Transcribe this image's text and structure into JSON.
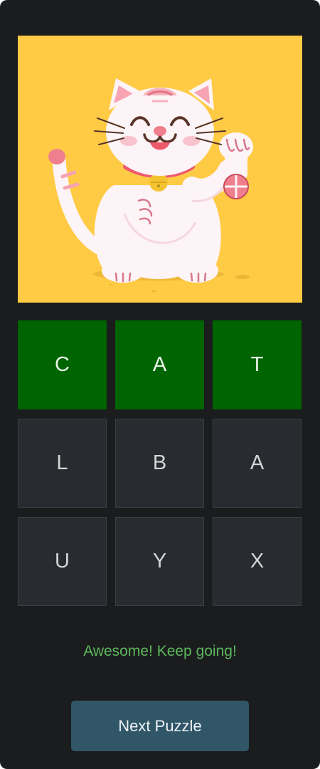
{
  "puzzle": {
    "image": {
      "icon": "maneki-neko-lucky-cat",
      "background_color": "#ffcb45"
    },
    "letters": [
      {
        "letter": "C",
        "state": "selected"
      },
      {
        "letter": "A",
        "state": "selected"
      },
      {
        "letter": "T",
        "state": "selected"
      },
      {
        "letter": "L",
        "state": "available"
      },
      {
        "letter": "B",
        "state": "available"
      },
      {
        "letter": "A",
        "state": "available"
      },
      {
        "letter": "U",
        "state": "available"
      },
      {
        "letter": "Y",
        "state": "available"
      },
      {
        "letter": "X",
        "state": "available"
      }
    ],
    "message": "Awesome! Keep going!",
    "next_button_label": "Next Puzzle"
  },
  "colors": {
    "app_background": "#1b1c1e",
    "tile_selected": "#006400",
    "tile_available": "#282b2f",
    "message": "#5cb85c",
    "button": "#315668"
  }
}
